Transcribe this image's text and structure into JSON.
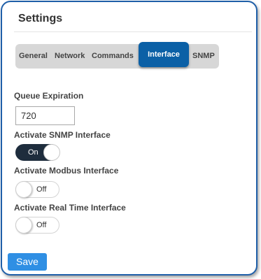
{
  "settings": {
    "title": "Settings",
    "tabs": [
      {
        "label": "General",
        "active": false
      },
      {
        "label": "Network",
        "active": false
      },
      {
        "label": "Commands",
        "active": false
      },
      {
        "label": "Interface",
        "active": true
      },
      {
        "label": "SNMP",
        "active": false
      }
    ],
    "queue_expiration": {
      "label": "Queue Expiration",
      "value": "720"
    },
    "snmp_interface": {
      "label": "Activate SNMP Interface",
      "state": "On"
    },
    "modbus_interface": {
      "label": "Activate Modbus Interface",
      "state": "Off"
    },
    "realtime_interface": {
      "label": "Activate Real Time Interface",
      "state": "Off"
    },
    "save_label": "Save"
  },
  "colors": {
    "panel_border": "#1f5fa8",
    "active_tab": "#0b60a6",
    "toggle_on": "#1e2d3d",
    "save_button": "#2f8fe4"
  }
}
